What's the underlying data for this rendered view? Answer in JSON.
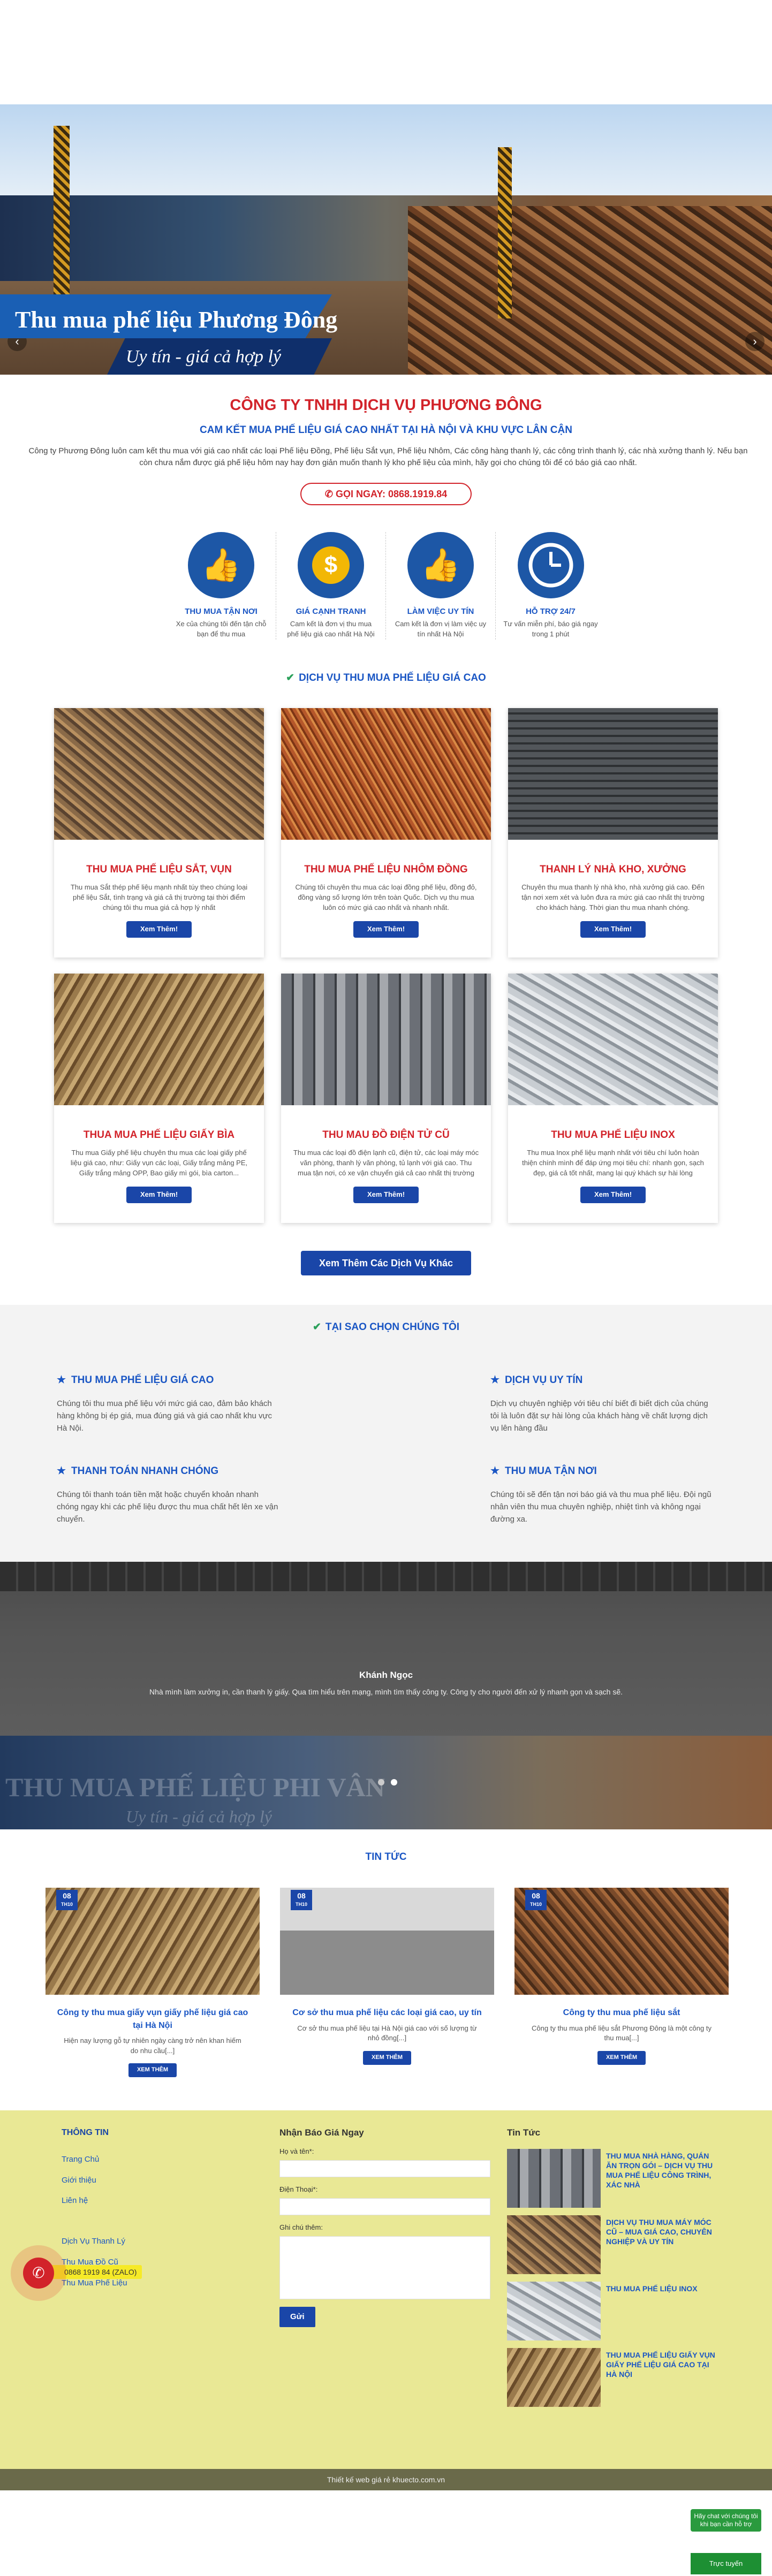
{
  "hero": {
    "title": "Thu mua phế liệu Phương Đông",
    "subtitle": "Uy tín - giá cả hợp lý"
  },
  "intro": {
    "company": "CÔNG TY TNHH DỊCH VỤ PHƯƠNG ĐÔNG",
    "commitment": "CAM KẾT MUA PHẾ LIỆU GIÁ CAO NHẤT TẠI HÀ NỘI VÀ KHU VỰC LÂN CẬN",
    "description": "Công ty Phương Đông luôn cam kết thu mua với giá cao nhất các loại Phế liệu Đồng, Phế liệu Sắt vụn, Phế liệu Nhôm, Các công hàng thanh lý, các công trình thanh lý, các nhà xưởng thanh lý. Nếu bạn còn chưa nắm được giá phế liệu hôm nay hay đơn giản muốn thanh lý kho phế liệu của mình, hãy gọi cho chúng tôi để có báo giá cao nhất.",
    "call_label": "GỌI NGAY: 0868.1919.84"
  },
  "features": [
    {
      "icon": "thumbs-up-icon",
      "title": "THU MUA TẬN NƠI",
      "text": "Xe của chúng tôi đến tận chỗ bạn để thu mua"
    },
    {
      "icon": "money-bag-icon",
      "title": "GIÁ CẠNH TRANH",
      "text": "Cam kết là đơn vị thu mua phế liệu giá cao nhất Hà Nội"
    },
    {
      "icon": "thumbs-up-icon",
      "title": "LÀM VIỆC UY TÍN",
      "text": "Cam kết là đơn vị làm việc uy tín nhất Hà Nội"
    },
    {
      "icon": "clock-icon",
      "title": "HỖ TRỢ 24/7",
      "text": "Tư vấn miễn phí, báo giá ngay trong 1 phút"
    }
  ],
  "services": {
    "title": "DỊCH VỤ THU MUA PHẾ LIỆU GIÁ CAO",
    "button_label": "Xem Thêm!",
    "more_label": "Xem Thêm Các Dịch Vụ Khác",
    "items": [
      {
        "title": "THU MUA PHẾ LIỆU SẮT, VỤN",
        "text": "Thu mua Sắt thép phế liệu mạnh nhất túy theo chúng loại phế liệu Sắt, tình trạng và giá cả thị trường tại thời điểm chúng tôi thu mua giá cả hợp lý nhất"
      },
      {
        "title": "THU MUA PHẾ LIỆU NHÔM ĐỒNG",
        "text": "Chúng tôi chuyên thu mua các loại đồng phế liệu, đồng đỏ, đồng vàng số lượng lớn trên toàn Quốc. Dịch vụ thu mua luôn có mức giá cao nhất và nhanh nhất."
      },
      {
        "title": "THANH LÝ NHÀ KHO, XƯỞNG",
        "text": "Chuyên thu mua thanh lý nhà kho, nhà xưởng giá cao. Đến tận nơi xem xét và luôn đưa ra mức giá cao nhất thị trường cho khách hàng. Thời gian thu mua nhanh chóng."
      },
      {
        "title": "THUA MUA PHẾ LIỆU GIẤY BÌA",
        "text": "Thu mua Giấy phế liệu chuyên thu mua các loại giấy phế liệu giá cao, như: Giấy vụn các loại, Giấy trắng mảng PE, Giấy trắng mảng OPP, Bao giấy mì gói, bìa carton..."
      },
      {
        "title": "THU MAU ĐỒ ĐIỆN TỬ CŨ",
        "text": "Thu mua các loại đồ điện lạnh cũ, điện tử, các loại máy móc văn phòng, thanh lý văn phòng, tủ lạnh với giá cao. Thu mua tận nơi, có xe vận chuyển giá cả cao nhất thị trường"
      },
      {
        "title": "THU MUA PHẾ LIỆU INOX",
        "text": "Thu mua Inox phế liệu mạnh nhất với tiêu chí luôn hoàn thiện chính mình để đáp ứng mọi tiêu chí: nhanh gọn, sạch đẹp, giá cả tốt nhất, mang lại quý khách sự hài lòng"
      }
    ]
  },
  "why": {
    "title": "TẠI SAO CHỌN CHÚNG TÔI",
    "items": [
      {
        "title": "THU MUA PHẾ LIỆU GIÁ CAO",
        "text": "Chúng tôi thu mua phế liệu với mức giá cao, đảm bảo khách hàng không bị ép giá, mua đúng giá và giá cao nhất khu vực Hà Nội."
      },
      {
        "title": "DỊCH VỤ UY TÍN",
        "text": "Dịch vụ chuyên nghiệp với tiêu chí biết đi biết dịch của chúng tôi là luôn đặt sự hài lòng của khách hàng về chất lượng dịch vụ lên hàng đầu"
      },
      {
        "title": "THANH TOÁN NHANH CHÓNG",
        "text": "Chúng tôi thanh toán tiền mặt hoặc chuyển khoản nhanh chóng ngay khi các phế liệu được thu mua chất hết lên xe vận chuyển."
      },
      {
        "title": "THU MUA TẬN NƠI",
        "text": "Chúng tôi sẽ đến tận nơi báo giá và thu mua phế liệu. Đội ngũ nhân viên thu mua chuyên nghiệp, nhiệt tình và không ngại đường xa."
      }
    ]
  },
  "testimonial": {
    "name": "Khánh Ngọc",
    "quote": "Nhà mình làm xưởng in, cần thanh lý giấy. Qua tìm hiểu trên mạng, mình tìm thấy công ty. Công ty cho người đến xử lý nhanh gọn và sạch sẽ."
  },
  "banner2": {
    "title": "THU MUA PHẾ LIỆU PHI VÂN",
    "subtitle": "Uy tín - giá cả hợp lý"
  },
  "news": {
    "title": "TIN TỨC",
    "button_label": "XEM THÊM",
    "items": [
      {
        "day": "08",
        "month": "TH10",
        "title": "Công ty thu mua giấy vụn giấy phế liệu giá cao tại Hà Nội",
        "text": "Hiện nay lượng gỗ tự nhiên ngày càng trở nên khan hiếm do nhu cầu[...]"
      },
      {
        "day": "08",
        "month": "TH10",
        "title": "Cơ sở thu mua phế liệu các loại giá cao, uy tín",
        "text": "Cơ sở thu mua phế liệu tại Hà Nội giá cao với số lượng từ nhỏ đồng[...]"
      },
      {
        "day": "08",
        "month": "TH10",
        "title": "Công ty thu mua phế liệu sắt",
        "text": "Công ty thu mua phế liệu sắt Phương Đông là một công ty thu mua[...]"
      }
    ]
  },
  "footer": {
    "info_title": "THÔNG TIN",
    "links": [
      "Trang Chủ",
      "Giới thiệu",
      "Liên hệ",
      "",
      "Dịch Vụ Thanh Lý",
      "Thu Mua Đồ Cũ",
      "Thu Mua Phế Liệu"
    ],
    "form_title": "Nhận Báo Giá Ngay",
    "name_label": "Họ và tên*:",
    "phone_label": "Điện Thoại*:",
    "note_label": "Ghi chú thêm:",
    "send_label": "Gửi",
    "news_title": "Tin Tức",
    "news_items": [
      "THU MUA NHÀ HÀNG, QUÁN ĂN TRỌN GÓI – DỊCH VỤ THU MUA PHẾ LIỆU CÔNG TRÌNH, XÁC NHÀ",
      "DỊCH VỤ THU MUA MÁY MÓC CŨ – MUA GIÁ CAO, CHUYÊN NGHIỆP VÀ UY TÍN",
      "THU MUA PHẾ LIỆU INOX",
      "THU MUA PHẾ LIỆU GIẤY VỤN GIẤY PHẾ LIỆU GIÁ CAO TẠI HÀ NỘI"
    ],
    "copyright": "Thiết kế web giá rẻ khuecto.com.vn"
  },
  "widgets": {
    "phone": "0868 1919 84 (ZALO)",
    "chat_text": "Hãy chat với chúng tôi khi bạn cần hỗ trợ",
    "chat_button": "Trực tuyến"
  }
}
